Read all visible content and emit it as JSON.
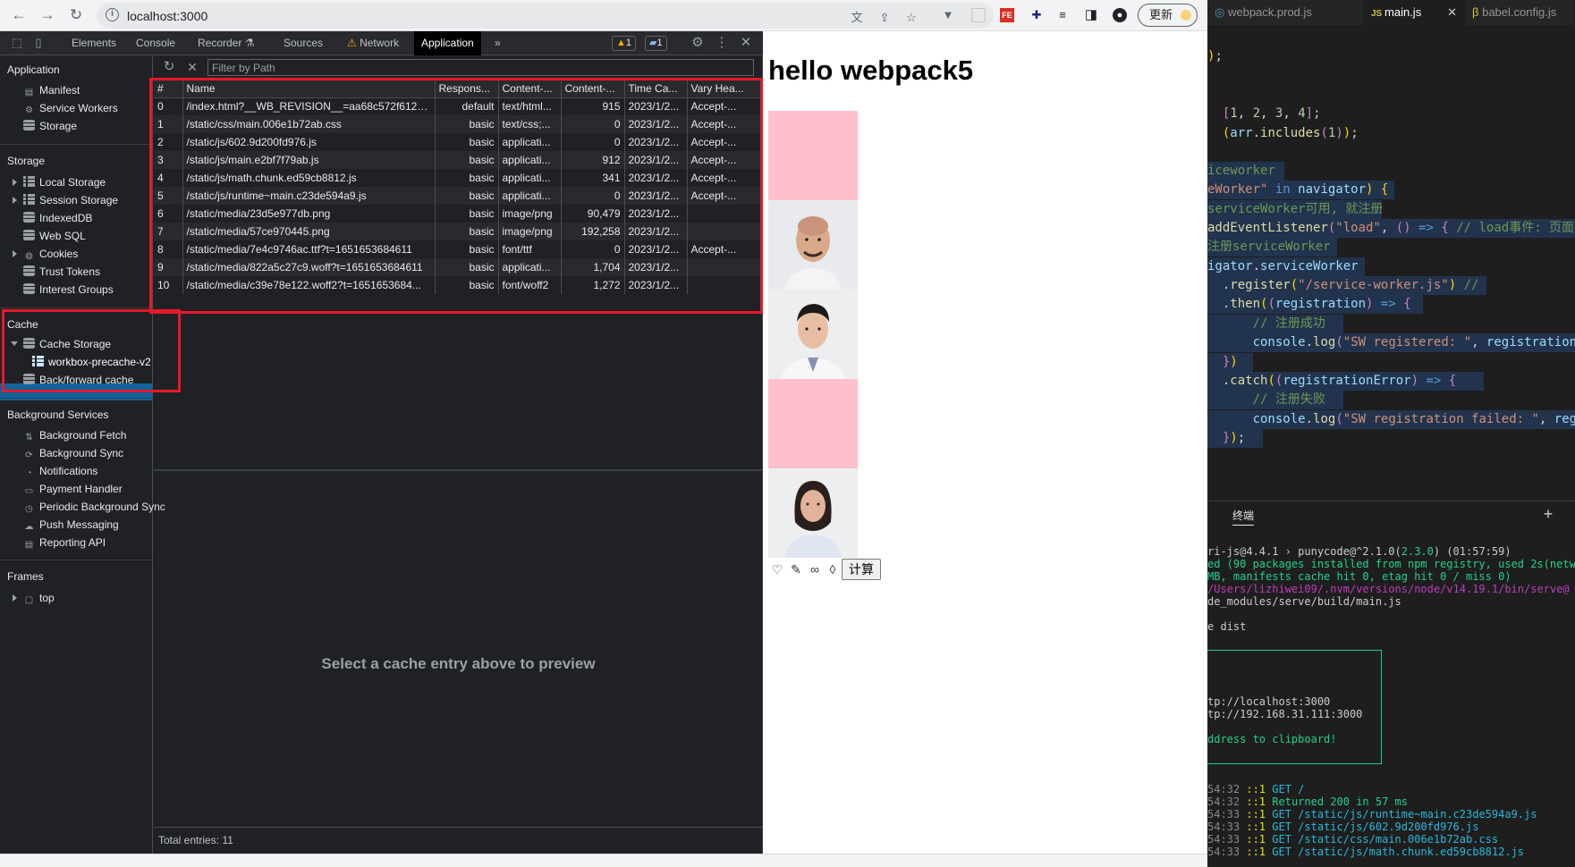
{
  "browser": {
    "url": "localhost:3000",
    "update_label": "更新"
  },
  "devtools": {
    "tabs": [
      "Elements",
      "Console",
      "Recorder ⚗",
      "Sources",
      "Network",
      "Application"
    ],
    "active_tab": "Application",
    "warnings_count": "1",
    "messages_count": "1",
    "more_tabs": "»",
    "sidebar": {
      "application_head": "Application",
      "application_items": [
        "Manifest",
        "Service Workers",
        "Storage"
      ],
      "storage_head": "Storage",
      "storage_items": [
        "Local Storage",
        "Session Storage",
        "IndexedDB",
        "Web SQL",
        "Cookies",
        "Trust Tokens",
        "Interest Groups"
      ],
      "cache_head": "Cache",
      "cache_items": [
        "Cache Storage",
        "workbox-precache-v2",
        "Back/forward cache"
      ],
      "background_head": "Background Services",
      "background_items": [
        "Background Fetch",
        "Background Sync",
        "Notifications",
        "Payment Handler",
        "Periodic Background Sync",
        "Push Messaging",
        "Reporting API"
      ],
      "frames_head": "Frames",
      "frames_items": [
        "top"
      ]
    },
    "filter_placeholder": "Filter by Path",
    "table": {
      "headers": [
        "#",
        "Name",
        "Respons...",
        "Content-...",
        "Content-...",
        "Time Ca...",
        "Vary Hea..."
      ],
      "rows": [
        [
          "0",
          "/index.html?__WB_REVISION__=aa68c572f6129...",
          "default",
          "text/html...",
          "915",
          "2023/1/2...",
          "Accept-..."
        ],
        [
          "1",
          "/static/css/main.006e1b72ab.css",
          "basic",
          "text/css;...",
          "0",
          "2023/1/2...",
          "Accept-..."
        ],
        [
          "2",
          "/static/js/602.9d200fd976.js",
          "basic",
          "applicati...",
          "0",
          "2023/1/2...",
          "Accept-..."
        ],
        [
          "3",
          "/static/js/main.e2bf7f79ab.js",
          "basic",
          "applicati...",
          "912",
          "2023/1/2...",
          "Accept-..."
        ],
        [
          "4",
          "/static/js/math.chunk.ed59cb8812.js",
          "basic",
          "applicati...",
          "341",
          "2023/1/2...",
          "Accept-..."
        ],
        [
          "5",
          "/static/js/runtime~main.c23de594a9.js",
          "basic",
          "applicati...",
          "0",
          "2023/1/2...",
          "Accept-..."
        ],
        [
          "6",
          "/static/media/23d5e977db.png",
          "basic",
          "image/png",
          "90,479",
          "2023/1/2...",
          ""
        ],
        [
          "7",
          "/static/media/57ce970445.png",
          "basic",
          "image/png",
          "192,258",
          "2023/1/2...",
          ""
        ],
        [
          "8",
          "/static/media/7e4c9746ac.ttf?t=1651653684611",
          "basic",
          "font/ttf",
          "0",
          "2023/1/2...",
          "Accept-..."
        ],
        [
          "9",
          "/static/media/822a5c27c9.woff?t=1651653684611",
          "basic",
          "applicati...",
          "1,704",
          "2023/1/2...",
          ""
        ],
        [
          "10",
          "/static/media/c39e78e122.woff2?t=1651653684...",
          "basic",
          "font/woff2",
          "1,272",
          "2023/1/2...",
          ""
        ]
      ]
    },
    "preview_message": "Select a cache entry above to preview",
    "total_entries": "Total entries: 11"
  },
  "page": {
    "heading": "hello webpack5",
    "calc_button": "计算"
  },
  "editor": {
    "tabs": [
      "webpack.prod.js",
      "main.js",
      "babel.config.js"
    ],
    "active_tab": "main.js",
    "terminal_title": "终端",
    "colors": {
      "keyword": "#569cd6",
      "string": "#ce9178",
      "comment": "#6a9955",
      "terminal_green": "#23d18b"
    }
  }
}
